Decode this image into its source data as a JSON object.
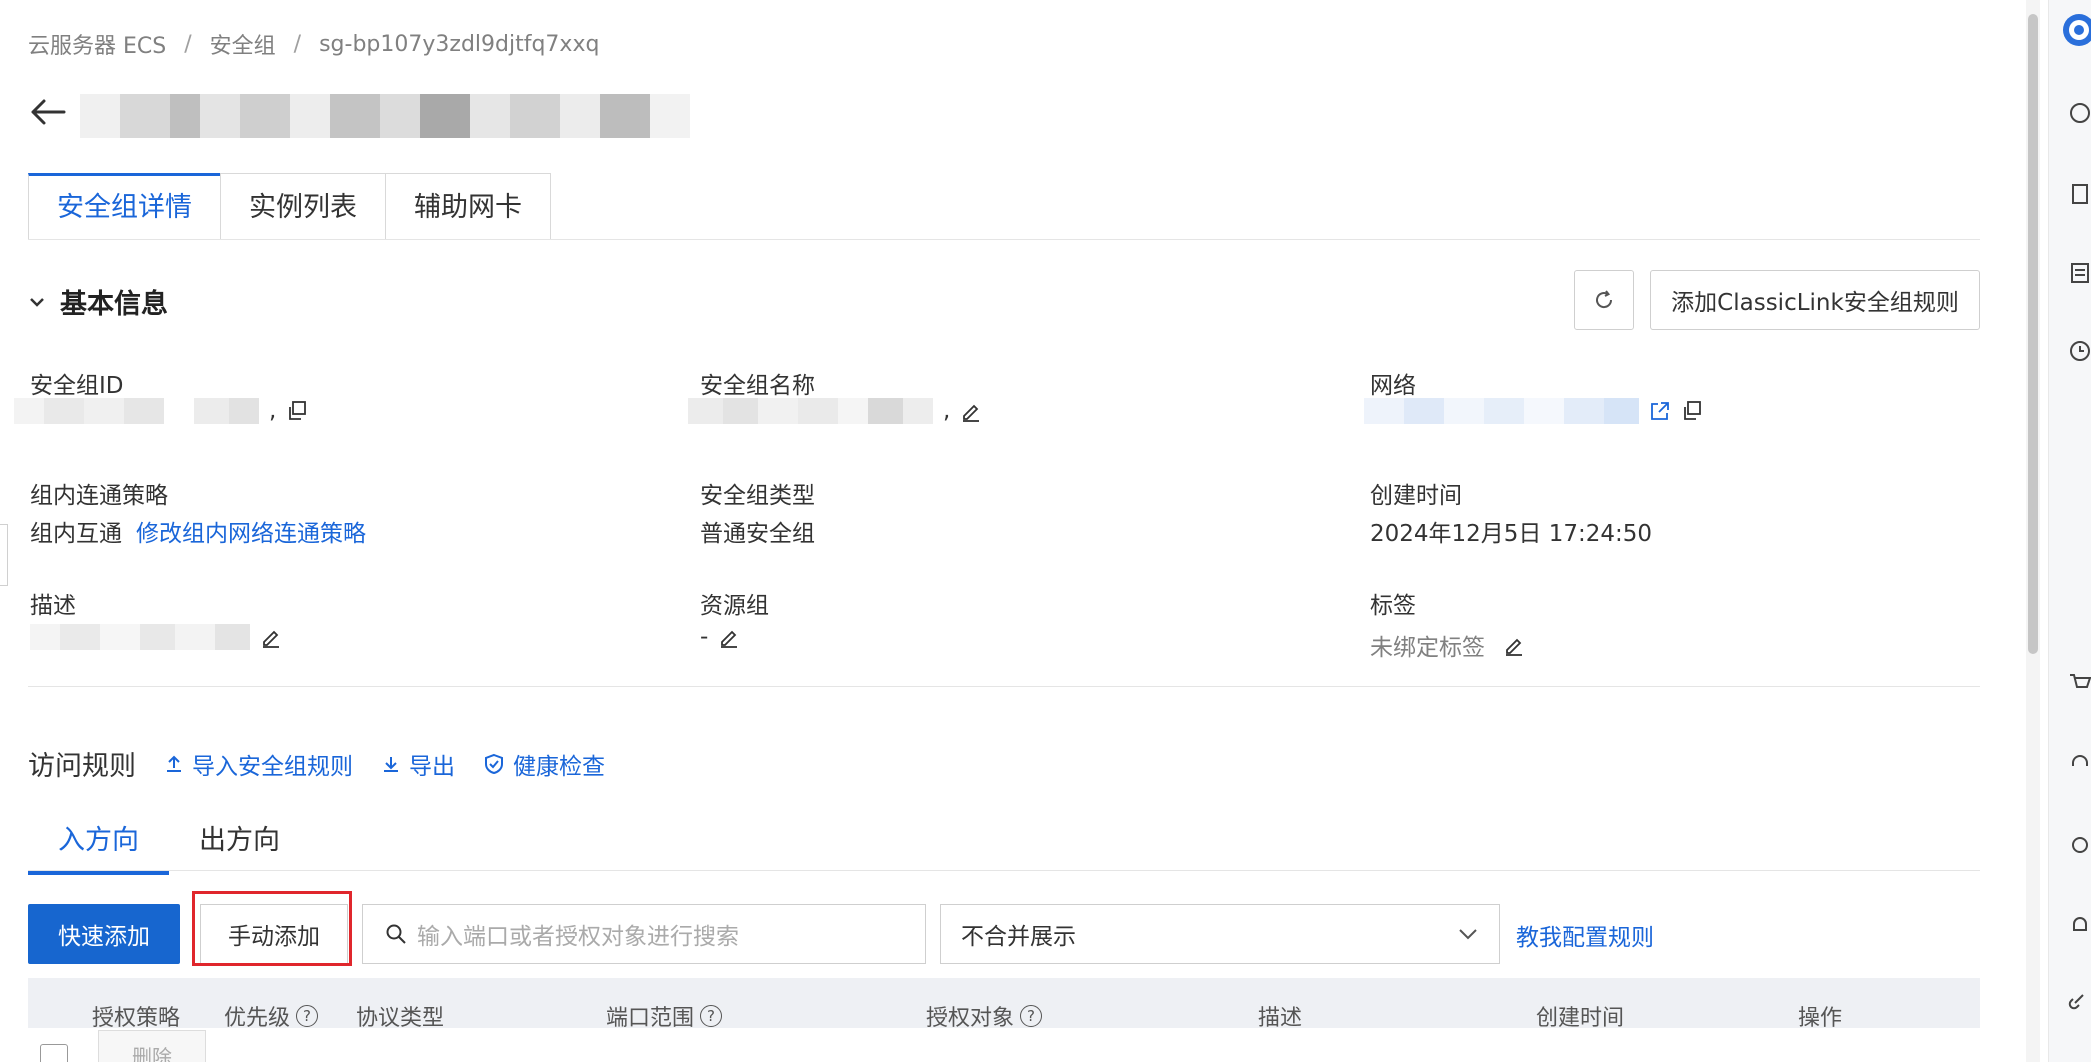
{
  "breadcrumb": {
    "items": [
      "云服务器 ECS",
      "安全组",
      "sg-bp107y3zdl9djtfq7xxq"
    ],
    "separator": "/"
  },
  "tabs": [
    "安全组详情",
    "实例列表",
    "辅助网卡"
  ],
  "basic_info": {
    "section_title": "基本信息",
    "classiclink_button": "添加ClassicLink安全组规则",
    "sg_id_label": "安全组ID",
    "sg_id_suffix": ",",
    "sg_name_label": "安全组名称",
    "sg_name_suffix": ",",
    "network_label": "网络",
    "intra_policy_label": "组内连通策略",
    "intra_policy_value": "组内互通",
    "intra_policy_link": "修改组内网络连通策略",
    "sg_type_label": "安全组类型",
    "sg_type_value": "普通安全组",
    "created_label": "创建时间",
    "created_value": "2024年12月5日 17:24:50",
    "desc_label": "描述",
    "rg_label": "资源组",
    "rg_value": "-",
    "tags_label": "标签",
    "tags_value": "未绑定标签"
  },
  "rules": {
    "title": "访问规则",
    "import_link": "导入安全组规则",
    "export_link": "导出",
    "health_link": "健康检查",
    "direction_tabs": [
      "入方向",
      "出方向"
    ],
    "quick_add": "快速添加",
    "manual_add": "手动添加",
    "search_placeholder": "输入端口或者授权对象进行搜索",
    "merge_select": "不合并展示",
    "teach_link": "教我配置规则",
    "columns": [
      "授权策略",
      "优先级",
      "协议类型",
      "端口范围",
      "授权对象",
      "描述",
      "创建时间",
      "操作"
    ],
    "delete_button": "删除"
  },
  "colors": {
    "accent": "#1a66d9",
    "primary_button": "#1766cf",
    "highlight_box": "#e0262c"
  }
}
